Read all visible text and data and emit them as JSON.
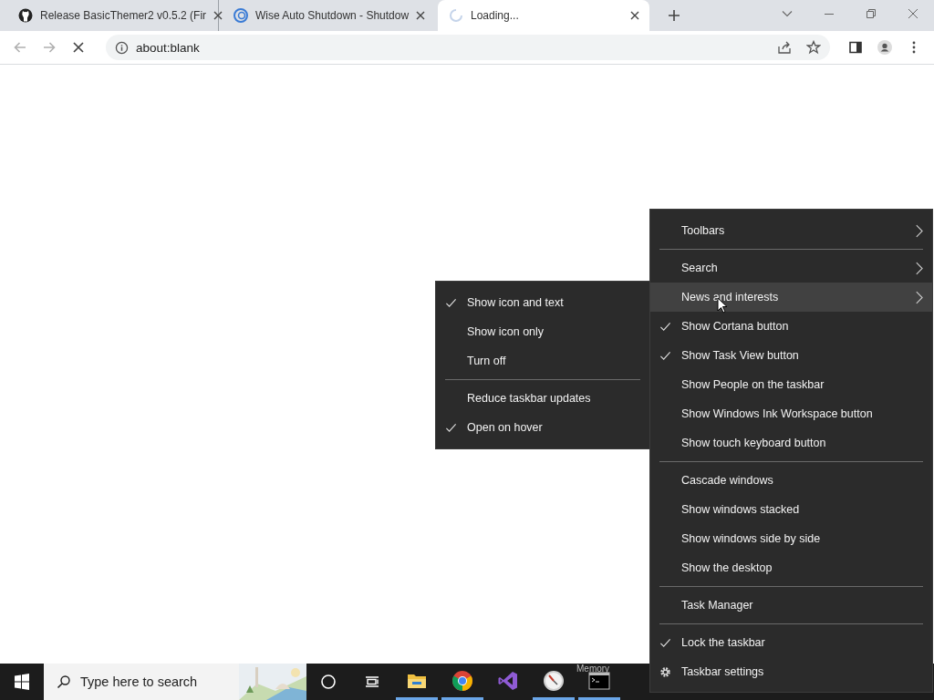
{
  "browser": {
    "tabs": [
      {
        "title": "Release BasicThemer2 v0.5.2 (Fir",
        "selected": false,
        "loading": false
      },
      {
        "title": "Wise Auto Shutdown - Shutdow",
        "selected": false,
        "loading": false
      },
      {
        "title": "Loading...",
        "selected": true,
        "loading": true
      }
    ],
    "address": "about:blank",
    "page_loading": true
  },
  "submenu": {
    "items": [
      {
        "kind": "item",
        "label": "Show icon and text",
        "checked": true
      },
      {
        "kind": "item",
        "label": "Show icon only",
        "checked": false
      },
      {
        "kind": "item",
        "label": "Turn off",
        "checked": false
      },
      {
        "kind": "separator"
      },
      {
        "kind": "item",
        "label": "Reduce taskbar updates",
        "checked": false
      },
      {
        "kind": "item",
        "label": "Open on hover",
        "checked": true
      }
    ]
  },
  "context_menu": {
    "items": [
      {
        "kind": "item",
        "label": "Toolbars",
        "checked": false,
        "submenu": true,
        "selected": false
      },
      {
        "kind": "separator"
      },
      {
        "kind": "item",
        "label": "Search",
        "checked": false,
        "submenu": true,
        "selected": false
      },
      {
        "kind": "item",
        "label": "News and interests",
        "checked": false,
        "submenu": true,
        "selected": true
      },
      {
        "kind": "item",
        "label": "Show Cortana button",
        "checked": true,
        "submenu": false,
        "selected": false
      },
      {
        "kind": "item",
        "label": "Show Task View button",
        "checked": true,
        "submenu": false,
        "selected": false
      },
      {
        "kind": "item",
        "label": "Show People on the taskbar",
        "checked": false,
        "submenu": false,
        "selected": false
      },
      {
        "kind": "item",
        "label": "Show Windows Ink Workspace button",
        "checked": false,
        "submenu": false,
        "selected": false
      },
      {
        "kind": "item",
        "label": "Show touch keyboard button",
        "checked": false,
        "submenu": false,
        "selected": false
      },
      {
        "kind": "separator"
      },
      {
        "kind": "item",
        "label": "Cascade windows",
        "checked": false,
        "submenu": false,
        "selected": false
      },
      {
        "kind": "item",
        "label": "Show windows stacked",
        "checked": false,
        "submenu": false,
        "selected": false
      },
      {
        "kind": "item",
        "label": "Show windows side by side",
        "checked": false,
        "submenu": false,
        "selected": false
      },
      {
        "kind": "item",
        "label": "Show the desktop",
        "checked": false,
        "submenu": false,
        "selected": false
      },
      {
        "kind": "separator"
      },
      {
        "kind": "item",
        "label": "Task Manager",
        "checked": false,
        "submenu": false,
        "selected": false
      },
      {
        "kind": "separator"
      },
      {
        "kind": "item",
        "label": "Lock the taskbar",
        "checked": true,
        "submenu": false,
        "selected": false
      },
      {
        "kind": "gear-item",
        "label": "Taskbar settings",
        "submenu": false,
        "selected": false
      }
    ]
  },
  "taskbar": {
    "search_placeholder": "Type here to search",
    "thumbnail_text": "Memory",
    "apps": [
      {
        "kind": "folder",
        "running": true
      },
      {
        "kind": "browser",
        "running": true
      },
      {
        "kind": "studio",
        "running": false
      },
      {
        "kind": "dial",
        "running": true
      },
      {
        "kind": "terminal",
        "running": true
      }
    ]
  }
}
